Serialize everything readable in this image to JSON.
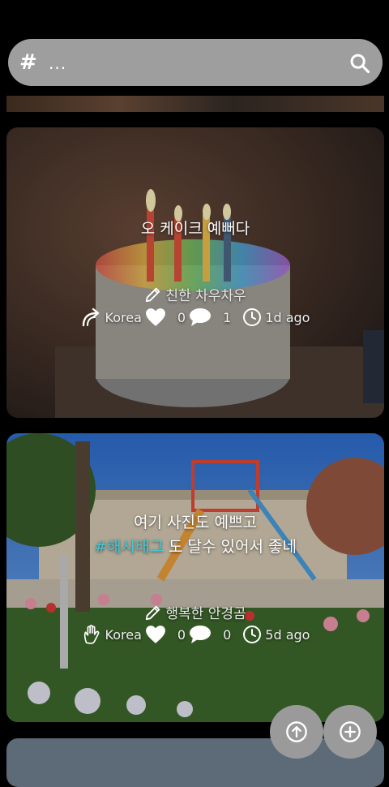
{
  "search": {
    "hash_symbol": "#",
    "placeholder": "...",
    "search_icon": "search-icon"
  },
  "posts": [
    {
      "caption_lines": [
        "오 케이크 예뻐다"
      ],
      "author": "친한 차우차우",
      "location": "Korea",
      "likes": "0",
      "comments": "1",
      "time": "1d ago",
      "location_icon": "curved-arrow-icon"
    },
    {
      "caption_line1": "여기 사진도 예쁘고",
      "caption_hashtag": "#해시태그",
      "caption_line2_rest": " 도 달수 있어서 좋네",
      "author": "행복한 안경곰",
      "location": "Korea",
      "likes": "0",
      "comments": "0",
      "time": "5d ago",
      "location_icon": "hand-icon"
    }
  ],
  "fabs": {
    "scroll_top_icon": "arrow-up-circle-icon",
    "add_icon": "plus-circle-icon"
  },
  "colors": {
    "search_bg": "#9e9e9e",
    "hashtag": "#41c7d6",
    "fab_bg": "#9a9a9a"
  }
}
